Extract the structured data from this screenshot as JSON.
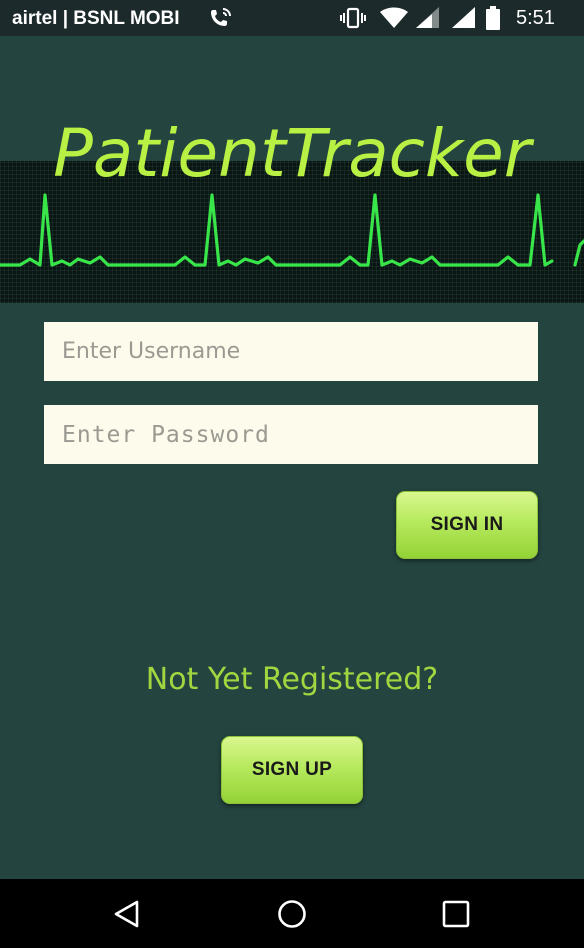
{
  "status_bar": {
    "carrier": "airtel | BSNL MOBI",
    "time": "5:51",
    "icons": [
      "wifi-calling-icon",
      "vibrate-icon",
      "wifi-icon",
      "signal-icon",
      "signal-icon",
      "battery-icon"
    ]
  },
  "app": {
    "title": "PatientTracker",
    "header_graphic": "ecg-heartbeat-line"
  },
  "login_form": {
    "username_placeholder": "Enter Username",
    "username_value": "",
    "password_placeholder": "Enter Password",
    "password_value": "",
    "sign_in_label": "SIGN IN"
  },
  "register": {
    "prompt": "Not Yet Registered?",
    "sign_up_label": "SIGN UP"
  },
  "nav_bar": {
    "icons": [
      "back-icon",
      "home-icon",
      "recents-icon"
    ]
  },
  "colors": {
    "background": "#24443f",
    "accent_green": "#b8f044",
    "button_green": "#b7ea5e",
    "field_background": "#fdfbeb",
    "status_bar": "#1c2a2b",
    "nav_bar": "#000000"
  }
}
